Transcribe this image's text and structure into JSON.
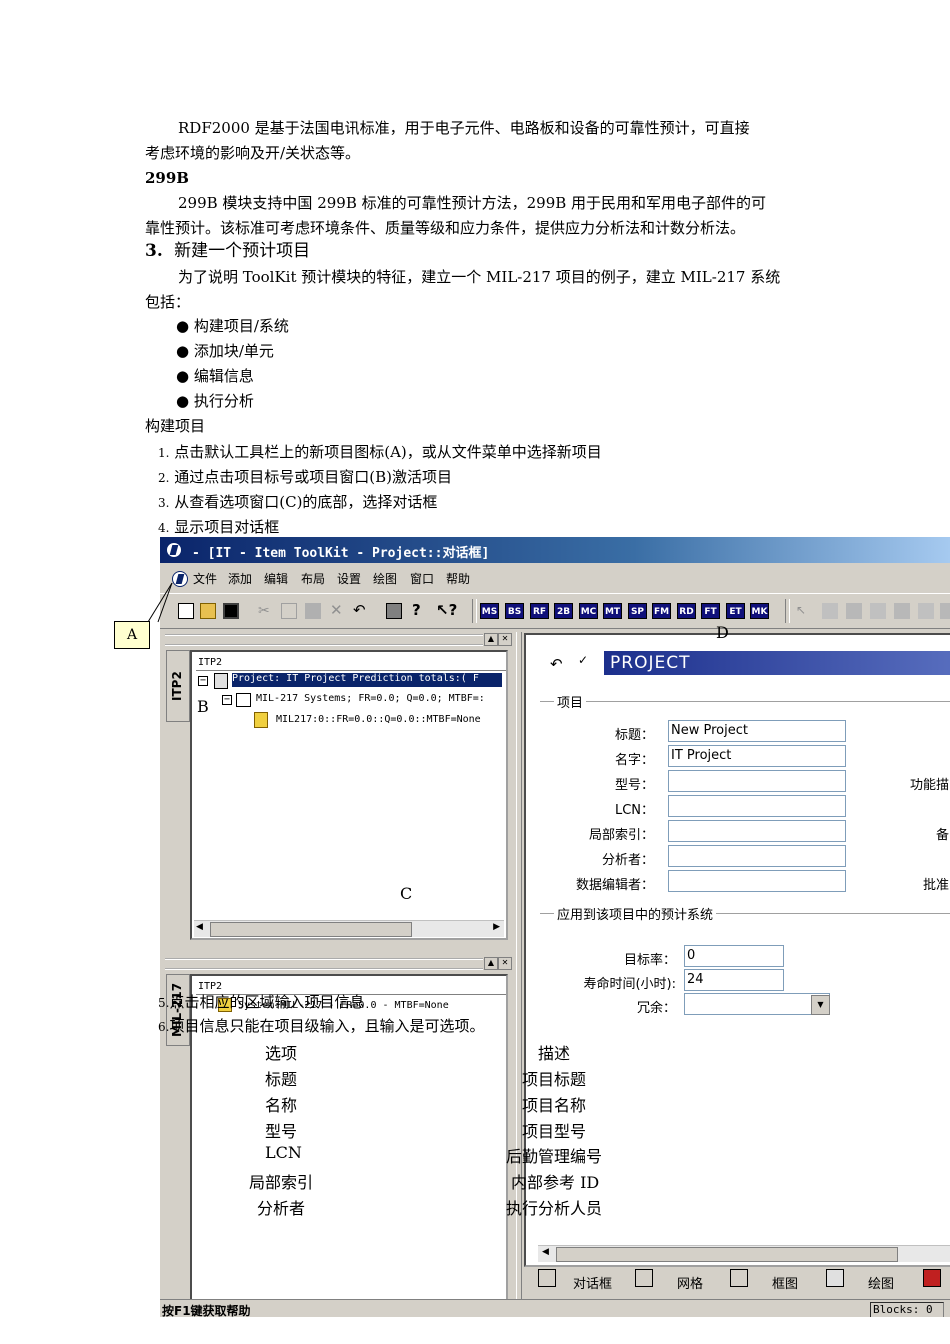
{
  "paragraphs": {
    "p1": "RDF2000 是基于法国电讯标准，用于电子元件、电路板和设备的可靠性预计，可直接",
    "p1b": "考虑环境的影响及开/关状态等。",
    "h299b": "299B",
    "p2": "299B 模块支持中国 299B 标准的可靠性预计方法，299B 用于民用和军用电子部件的可",
    "p2b": "靠性预计。该标准可考虑环境条件、质量等级和应力条件，提供应力分析法和计数分析法。",
    "section_num": "3.",
    "section_title": "新建一个预计项目",
    "p3": "为了说明 ToolKit 预计模块的特征，建立一个 MIL-217 项目的例子，建立 MIL-217 系统",
    "p3b": "包括："
  },
  "bullets": [
    "构建项目/系统",
    "添加块/单元",
    "编辑信息",
    "执行分析"
  ],
  "subheading": "构建项目",
  "steps": [
    {
      "n": "1.",
      "text": "点击默认工具栏上的新项目图标(A)，或从文件菜单中选择新项目"
    },
    {
      "n": "2.",
      "text": "通过点击项目标号或项目窗口(B)激活项目"
    },
    {
      "n": "3.",
      "text": "从查看选项窗口(C)的底部，选择对话框"
    },
    {
      "n": "4.",
      "text": "显示项目对话框"
    },
    {
      "n": "5.",
      "text": "点击相应的区域输入项目信息"
    },
    {
      "n": "6.",
      "text": "项目信息只能在项目级输入，且输入是可选项。"
    }
  ],
  "callouts": {
    "a": "A",
    "b": "B",
    "c": "C",
    "d": "D"
  },
  "app": {
    "title": "- [IT - Item ToolKit - Project::对话框]",
    "menu": [
      "文件",
      "添加",
      "编辑",
      "布局",
      "设置",
      "绘图",
      "窗口",
      "帮助"
    ],
    "modules": [
      "MS",
      "BS",
      "RF",
      "2B",
      "MC",
      "MT",
      "SP",
      "FM",
      "RD",
      "FT",
      "ET",
      "MK"
    ],
    "tree_top": {
      "tab": "ITP2",
      "root": "ITP2",
      "row1": "Project:  IT Project Prediction totals:( F",
      "row2": "MIL-217 Systems;  FR=0.0; Q=0.0; MTBF=:",
      "row3": "MIL217:0::FR=0.0::Q=0.0::MTBF=None"
    },
    "tree_bottom": {
      "tab": "MIL-217",
      "root": "ITP2",
      "row1": "System:MIL-217 - FR=0.0 - MTBF=None"
    },
    "form": {
      "header": "PROJECT",
      "group1": "项目",
      "fields": [
        {
          "label": "标题：",
          "value": "New Project"
        },
        {
          "label": "名字：",
          "value": "IT Project"
        },
        {
          "label": "型号：",
          "value": ""
        },
        {
          "label": "LCN：",
          "value": ""
        },
        {
          "label": "局部索引：",
          "value": ""
        },
        {
          "label": "分析者：",
          "value": ""
        },
        {
          "label": "数据编辑者：",
          "value": ""
        }
      ],
      "right_labels": [
        "功能描",
        "备",
        "批准"
      ],
      "group2": "应用到该项目中的预计系统",
      "target_label": "目标率：",
      "target_value": "0",
      "life_label": "寿命时间(小时):",
      "life_value": "24",
      "redundancy_label": "冗余：",
      "redundancy_value": ""
    },
    "bottom_tabs": [
      "对话框",
      "网格",
      "框图",
      "绘图"
    ],
    "status_left": "按F1键获取帮助",
    "status_right": "Blocks: 0"
  },
  "table": {
    "header": [
      "选项",
      "描述"
    ],
    "rows": [
      [
        "标题",
        "项目标题"
      ],
      [
        "名称",
        "项目名称"
      ],
      [
        "型号",
        "项目型号"
      ],
      [
        "LCN",
        "后勤管理编号"
      ],
      [
        "局部索引",
        "内部参考 ID"
      ],
      [
        "分析者",
        "执行分析人员"
      ]
    ]
  }
}
